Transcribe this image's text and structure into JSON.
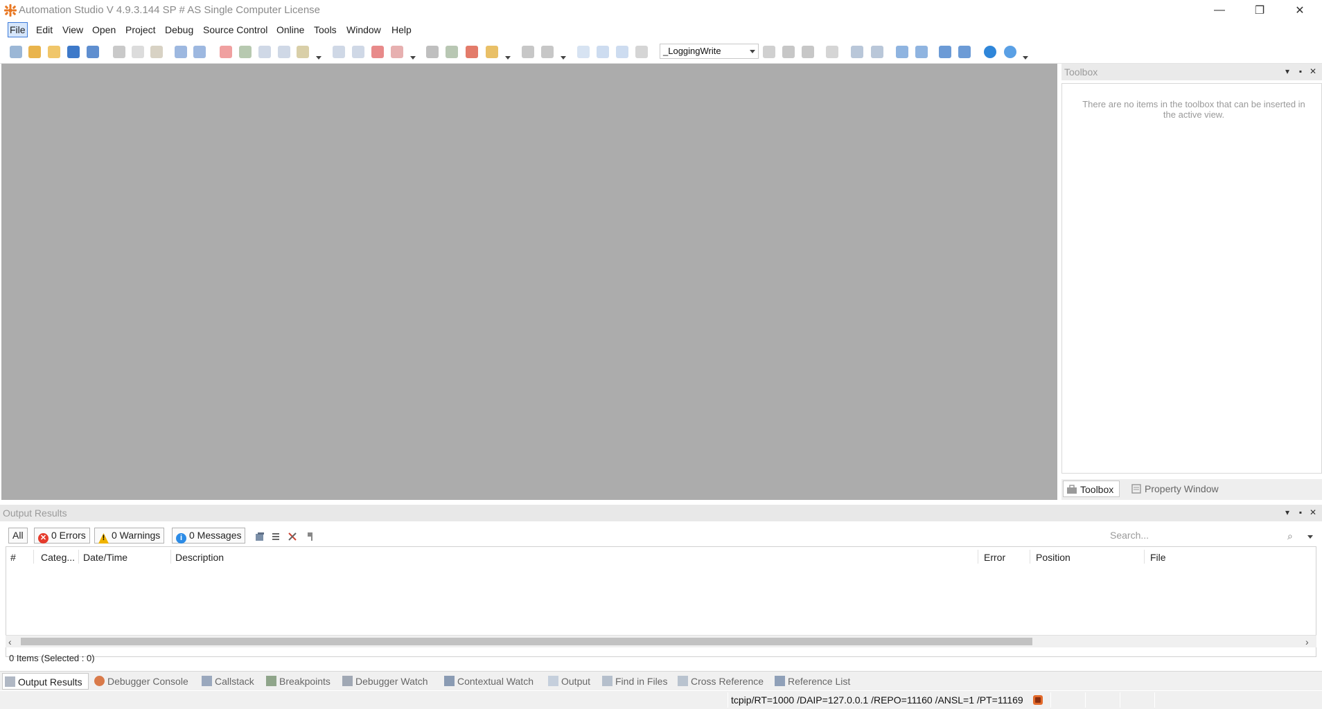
{
  "app": {
    "title": "Automation Studio V 4.9.3.144 SP # AS Single Computer License",
    "brand_color": "#e87722"
  },
  "window_controls": {
    "minimize": "—",
    "maximize": "❐",
    "close": "✕"
  },
  "menu": {
    "items": [
      {
        "label": "File",
        "active": true
      },
      {
        "label": "Edit"
      },
      {
        "label": "View"
      },
      {
        "label": "Open"
      },
      {
        "label": "Project"
      },
      {
        "label": "Debug"
      },
      {
        "label": "Source Control"
      },
      {
        "label": "Online"
      },
      {
        "label": "Tools"
      },
      {
        "label": "Window"
      },
      {
        "label": "Help"
      }
    ]
  },
  "toolbar": {
    "configuration": "_LoggingWrite"
  },
  "toolbox": {
    "title": "Toolbox",
    "empty_message": "There are no items in the toolbox that can be inserted in the active view.",
    "tabs": [
      {
        "label": "Toolbox",
        "active": true
      },
      {
        "label": "Property Window"
      }
    ]
  },
  "output": {
    "title": "Output Results",
    "filters": {
      "all": "All",
      "errors": "0 Errors",
      "warnings": "0 Warnings",
      "messages": "0 Messages"
    },
    "search_placeholder": "Search...",
    "columns": [
      "#",
      "Categ...",
      "Date/Time",
      "Description",
      "Error",
      "Position",
      "File"
    ],
    "status": "0 Items (Selected : 0)"
  },
  "bottom_tabs": [
    {
      "label": "Output Results",
      "active": true
    },
    {
      "label": "Debugger Console"
    },
    {
      "label": "Callstack"
    },
    {
      "label": "Breakpoints"
    },
    {
      "label": "Debugger Watch"
    },
    {
      "label": "Contextual Watch"
    },
    {
      "label": "Output"
    },
    {
      "label": "Find in Files"
    },
    {
      "label": "Cross Reference"
    },
    {
      "label": "Reference List"
    }
  ],
  "statusbar": {
    "connection": "tcpip/RT=1000 /DAIP=127.0.0.1 /REPO=11160 /ANSL=1 /PT=11169"
  }
}
